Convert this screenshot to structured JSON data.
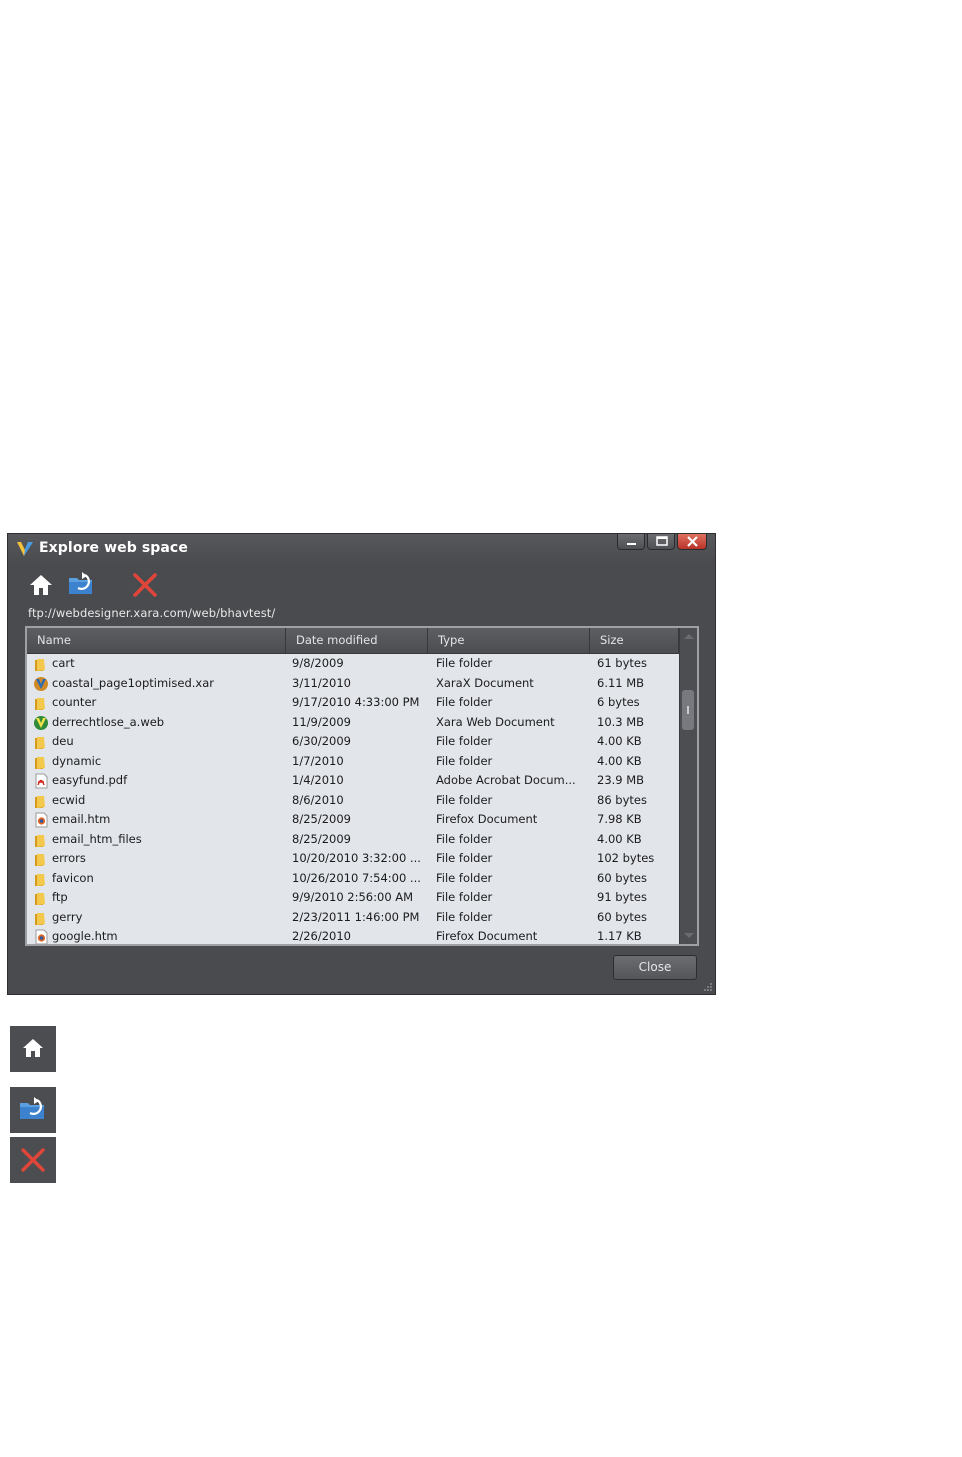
{
  "window": {
    "title": "Explore web space",
    "minimize_icon": "minimize-icon",
    "maximize_icon": "maximize-icon",
    "close_icon": "close-icon"
  },
  "toolbar": {
    "home_icon": "home-icon",
    "refresh_folder_icon": "folder-refresh-icon",
    "delete_icon": "delete-x-icon"
  },
  "address": "ftp://webdesigner.xara.com/web/bhavtest/",
  "columns": {
    "name": "Name",
    "date": "Date modified",
    "type": "Type",
    "size": "Size"
  },
  "files": [
    {
      "name": "cart",
      "date": "9/8/2009",
      "type": "File folder",
      "size": "61 bytes",
      "icon": "folder"
    },
    {
      "name": "coastal_page1optimised.xar",
      "date": "3/11/2010",
      "type": "XaraX Document",
      "size": "6.11 MB",
      "icon": "xar"
    },
    {
      "name": "counter",
      "date": "9/17/2010 4:33:00 PM",
      "type": "File folder",
      "size": "6 bytes",
      "icon": "folder"
    },
    {
      "name": "derrechtlose_a.web",
      "date": "11/9/2009",
      "type": "Xara Web Document",
      "size": "10.3 MB",
      "icon": "web"
    },
    {
      "name": "deu",
      "date": "6/30/2009",
      "type": "File folder",
      "size": "4.00 KB",
      "icon": "folder"
    },
    {
      "name": "dynamic",
      "date": "1/7/2010",
      "type": "File folder",
      "size": "4.00 KB",
      "icon": "folder"
    },
    {
      "name": "easyfund.pdf",
      "date": "1/4/2010",
      "type": "Adobe Acrobat Docum...",
      "size": "23.9 MB",
      "icon": "pdf"
    },
    {
      "name": "ecwid",
      "date": "8/6/2010",
      "type": "File folder",
      "size": "86 bytes",
      "icon": "folder"
    },
    {
      "name": "email.htm",
      "date": "8/25/2009",
      "type": "Firefox Document",
      "size": "7.98 KB",
      "icon": "firefox"
    },
    {
      "name": "email_htm_files",
      "date": "8/25/2009",
      "type": "File folder",
      "size": "4.00 KB",
      "icon": "folder"
    },
    {
      "name": "errors",
      "date": "10/20/2010 3:32:00 ...",
      "type": "File folder",
      "size": "102 bytes",
      "icon": "folder"
    },
    {
      "name": "favicon",
      "date": "10/26/2010 7:54:00 ...",
      "type": "File folder",
      "size": "60 bytes",
      "icon": "folder"
    },
    {
      "name": "ftp",
      "date": "9/9/2010 2:56:00 AM",
      "type": "File folder",
      "size": "91 bytes",
      "icon": "folder"
    },
    {
      "name": "gerry",
      "date": "2/23/2011 1:46:00 PM",
      "type": "File folder",
      "size": "60 bytes",
      "icon": "folder"
    },
    {
      "name": "google.htm",
      "date": "2/26/2010",
      "type": "Firefox Document",
      "size": "1.17 KB",
      "icon": "firefox"
    }
  ],
  "close_button": "Close",
  "legend": {
    "home_icon": "home-icon",
    "refresh_folder_icon": "folder-refresh-icon",
    "delete_icon": "delete-x-icon"
  },
  "colors": {
    "dialog_bg": "#4a4b4e",
    "list_bg": "#e2e5ea",
    "delete_red": "#e0453a",
    "folder_yellow": "#e8b930"
  }
}
